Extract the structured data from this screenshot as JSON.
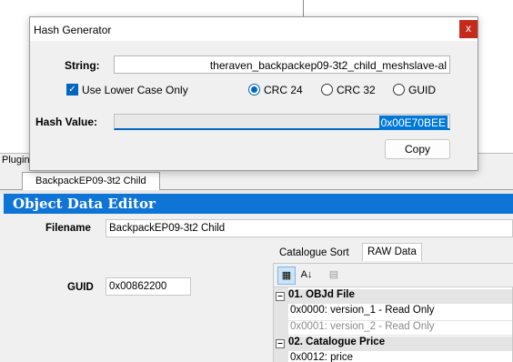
{
  "plugin": {
    "title": "Plugin",
    "doc_tab": "BackpackEP09-3t2 Child",
    "editor_header": "Object Data Editor",
    "filename_label": "Filename",
    "filename_value": "BackpackEP09-3t2 Child",
    "guid_label": "GUID",
    "guid_value": "0x00862200",
    "tabs": [
      {
        "label": "Catalogue Sort",
        "active": false
      },
      {
        "label": "RAW Data",
        "active": true
      }
    ],
    "categories": [
      {
        "label": "01. OBJd File",
        "rows": [
          {
            "text": "0x0000: version_1 - Read Only",
            "dim": false
          },
          {
            "text": "0x0001: version_2 - Read Only",
            "dim": true
          }
        ]
      },
      {
        "label": "02. Catalogue Price",
        "rows": [
          {
            "text": "0x0012: price",
            "dim": false
          }
        ]
      }
    ]
  },
  "dialog": {
    "title": "Hash Generator",
    "close_glyph": "x",
    "string_label": "String:",
    "string_value": "theraven_backpackep09-3t2_child_meshslave-al",
    "lowercase_label": "Use Lower Case Only",
    "lowercase_checked": true,
    "options": [
      {
        "label": "CRC 24",
        "selected": true
      },
      {
        "label": "CRC 32",
        "selected": false
      },
      {
        "label": "GUID",
        "selected": false
      }
    ],
    "hash_label": "Hash Value:",
    "hash_value": "0x00E70BEE",
    "copy_label": "Copy"
  },
  "colors": {
    "header_blue": "#0e74d5",
    "selection_blue": "#0078d7",
    "close_red": "#c42b1c"
  }
}
